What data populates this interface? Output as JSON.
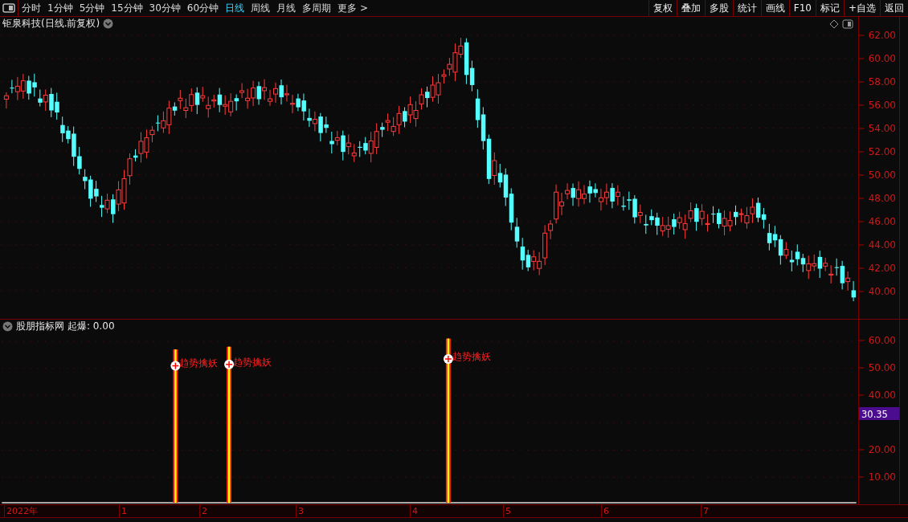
{
  "toolbar": {
    "periods": [
      {
        "label": "分时",
        "selected": false
      },
      {
        "label": "1分钟",
        "selected": false
      },
      {
        "label": "5分钟",
        "selected": false
      },
      {
        "label": "15分钟",
        "selected": false
      },
      {
        "label": "30分钟",
        "selected": false
      },
      {
        "label": "60分钟",
        "selected": false
      },
      {
        "label": "日线",
        "selected": true
      },
      {
        "label": "周线",
        "selected": false
      },
      {
        "label": "月线",
        "selected": false
      },
      {
        "label": "多周期",
        "selected": false
      },
      {
        "label": "更多 >",
        "selected": false
      }
    ],
    "actions": [
      "复权",
      "叠加",
      "多股",
      "统计",
      "画线",
      "F10",
      "标记",
      "+自选",
      "返回"
    ]
  },
  "price_chart": {
    "title": "钜泉科技(日线.前复权)",
    "yaxis": [
      "62.00",
      "60.00",
      "58.00",
      "56.00",
      "54.00",
      "52.00",
      "50.00",
      "48.00",
      "46.00",
      "44.00",
      "42.00",
      "40.00"
    ]
  },
  "indicator": {
    "title": "股朋指标网",
    "reading": "起爆: 0.00",
    "yaxis": [
      "60.00",
      "50.00",
      "40.00",
      "20.00",
      "10.00"
    ],
    "current_value": "30.35",
    "signals": [
      {
        "label": "趋势擒妖"
      },
      {
        "label": "趋势擒妖"
      },
      {
        "label": "趋势擒妖"
      }
    ]
  },
  "time_axis": [
    "2022年",
    "1",
    "2",
    "3",
    "4",
    "5",
    "6",
    "7"
  ]
}
